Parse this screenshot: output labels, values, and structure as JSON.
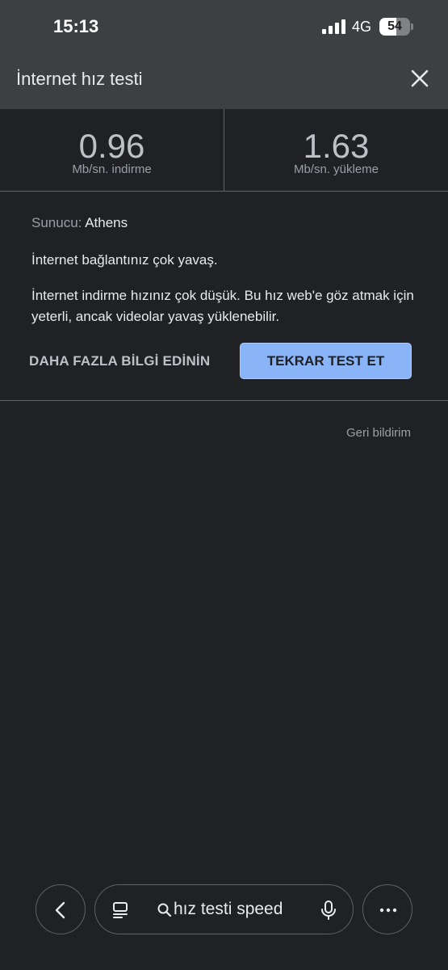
{
  "status_bar": {
    "time": "15:13",
    "network": "4G",
    "battery": "54",
    "battery_level": 0.54
  },
  "panel": {
    "title": "İnternet hız testi",
    "close_icon": "close-icon"
  },
  "results": {
    "download_value": "0.96",
    "download_unit": "Mb/sn. indirme",
    "upload_value": "1.63",
    "upload_unit": "Mb/sn. yükleme"
  },
  "server": {
    "label": "Sunucu:",
    "value": "Athens"
  },
  "status_message": "İnternet bağlantınız çok yavaş.",
  "description": "İnternet indirme hızınız çok düşük. Bu hız web'e göz atmak için yeterli, ancak videolar yavaş yüklenebilir.",
  "actions": {
    "learn_more": "DAHA FAZLA BİLGİ EDİNİN",
    "retest": "TEKRAR TEST ET"
  },
  "feedback": "Geri bildirim",
  "bottom_bar": {
    "query": "hız testi speed",
    "icons": [
      "back-icon",
      "tabs-icon",
      "search-icon",
      "mic-icon",
      "more-icon"
    ]
  },
  "colors": {
    "background": "#202124",
    "panel": "#3c4043",
    "accent": "#8ab4f8"
  }
}
